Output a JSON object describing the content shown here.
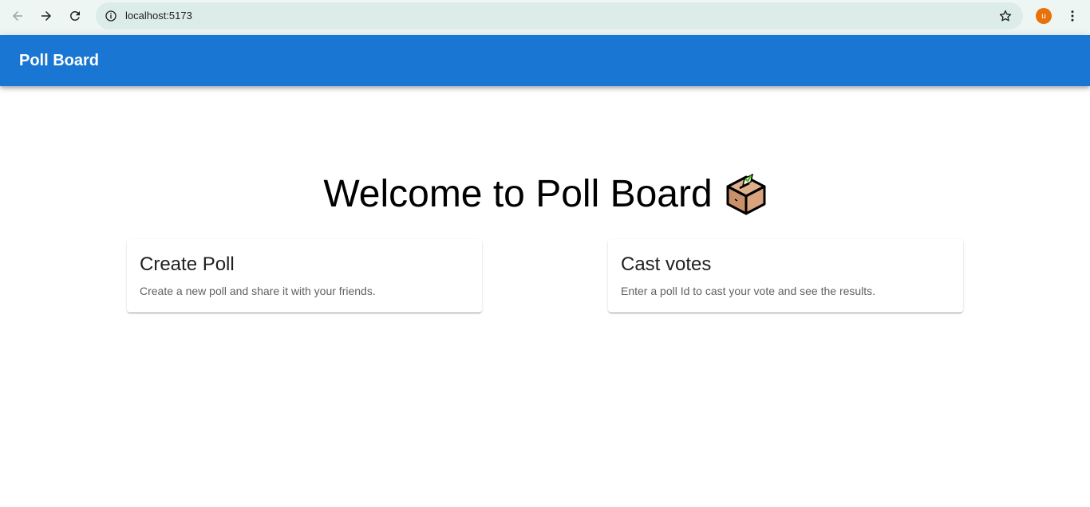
{
  "browser": {
    "url": "localhost:5173",
    "profile_initial": "u",
    "profile_color": "#e8710a"
  },
  "appbar": {
    "title": "Poll Board",
    "color": "#1976d2"
  },
  "main": {
    "heading": "Welcome to Poll Board",
    "heading_icon": "ballot-box-icon",
    "cards": [
      {
        "title": "Create Poll",
        "description": "Create a new poll and share it with your friends."
      },
      {
        "title": "Cast votes",
        "description": "Enter a poll Id to cast your vote and see the results."
      }
    ]
  }
}
